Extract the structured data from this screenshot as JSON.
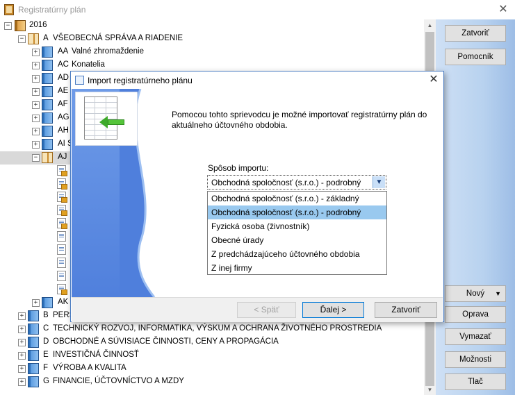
{
  "window": {
    "title": "Registratúrny plán"
  },
  "tree": {
    "root": "2016",
    "section_a": {
      "code": "A",
      "label": "VŠEOBECNÁ SPRÁVA A RIADENIE"
    },
    "a_children": [
      {
        "code": "AA",
        "label": "Valné zhromaždenie"
      },
      {
        "code": "AC",
        "label": "Konatelia"
      },
      {
        "code": "AD",
        "label": ""
      },
      {
        "code": "AE",
        "label": ""
      },
      {
        "code": "AF",
        "label": ""
      },
      {
        "code": "AG",
        "label": ""
      },
      {
        "code": "AH",
        "label": ""
      },
      {
        "code": "AI",
        "label": "S"
      },
      {
        "code": "AJ",
        "label": ""
      }
    ],
    "ak": {
      "code": "AK",
      "label": ""
    },
    "sections": [
      {
        "code": "B",
        "label": "PERS"
      },
      {
        "code": "C",
        "label": "TECHNICKÝ ROZVOJ, INFORMATIKA, VÝSKUM A OCHRANA ŽIVOTNÉHO PROSTREDIA"
      },
      {
        "code": "D",
        "label": "OBCHODNÉ A SÚVISIACE ČINNOSTI, CENY A PROPAGÁCIA"
      },
      {
        "code": "E",
        "label": "INVESTIČNÁ ČINNOSŤ"
      },
      {
        "code": "F",
        "label": "VÝROBA A KVALITA"
      },
      {
        "code": "G",
        "label": "FINANCIE, ÚČTOVNÍCTVO A MZDY"
      }
    ]
  },
  "side_buttons": {
    "close": "Zatvoriť",
    "help": "Pomocník",
    "new": "Nový",
    "edit": "Oprava",
    "delete": "Vymazať",
    "options": "Možnosti",
    "print": "Tlač"
  },
  "dialog": {
    "title": "Import registratúrneho plánu",
    "intro": "Pomocou tohto sprievodcu je možné importovať registratúrny plán do aktuálneho účtovného obdobia.",
    "method_label": "Spôsob importu:",
    "selected": "Obchodná spoločnosť (s.r.o.) - podrobný",
    "options": [
      "Obchodná spoločnosť (s.r.o.) - základný",
      "Obchodná spoločnosť (s.r.o.) - podrobný",
      "Fyzická osoba (živnostník)",
      "Obecné úrady",
      "Z predchádzajúceho účtovného obdobia",
      "Z inej firmy"
    ],
    "back": "< Späť",
    "next": "Ďalej >",
    "close": "Zatvoriť"
  }
}
